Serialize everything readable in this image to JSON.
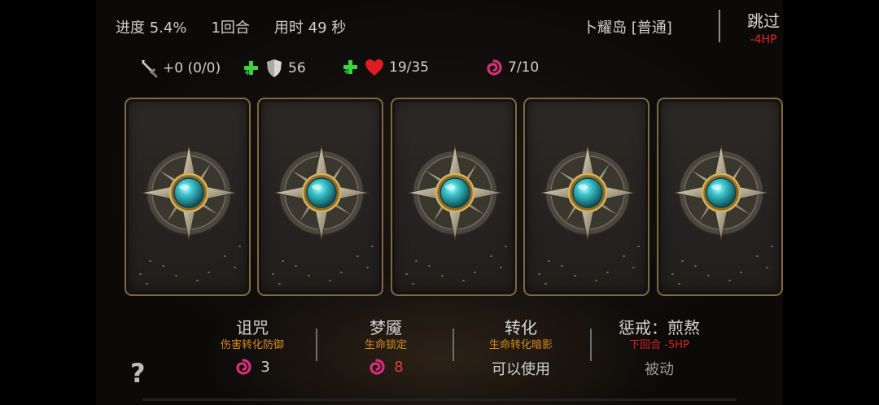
{
  "status": {
    "progress": "进度 5.4%",
    "round": "1回合",
    "time": "用时 49 秒",
    "location": "卜耀岛 [普通]"
  },
  "skip": {
    "label": "跳过",
    "cost": "-4HP"
  },
  "stats": {
    "attack": "+0 (0/0)",
    "defense": "56",
    "health": "19/35",
    "dream": "7/10"
  },
  "cards": [
    {
      "name": "card-1"
    },
    {
      "name": "card-2"
    },
    {
      "name": "card-3"
    },
    {
      "name": "card-4"
    },
    {
      "name": "card-5"
    }
  ],
  "choices": [
    {
      "name": "诅咒",
      "desc": "伤害转化防御",
      "value": "3"
    },
    {
      "name": "梦魇",
      "desc": "生命锁定",
      "value": "8"
    },
    {
      "name": "转化",
      "desc": "生命转化暗影",
      "value": "可以使用"
    },
    {
      "name": "惩戒：煎熬",
      "desc": "下回合 -5HP",
      "value": "被动"
    }
  ],
  "help": "?",
  "colors": {
    "accent_orange": "#d9891e",
    "danger_red": "#e0262a",
    "heal_green": "#37d63f",
    "swirl_pink": "#d4307a",
    "card_border": "#7b6a42",
    "gem_cyan": "#3fc7cf"
  },
  "icons": {
    "attack": "sword-icon",
    "defense": "shield-icon",
    "health": "heart-icon",
    "dream": "swirl-icon",
    "card_emblem": "compass-star-icon"
  }
}
